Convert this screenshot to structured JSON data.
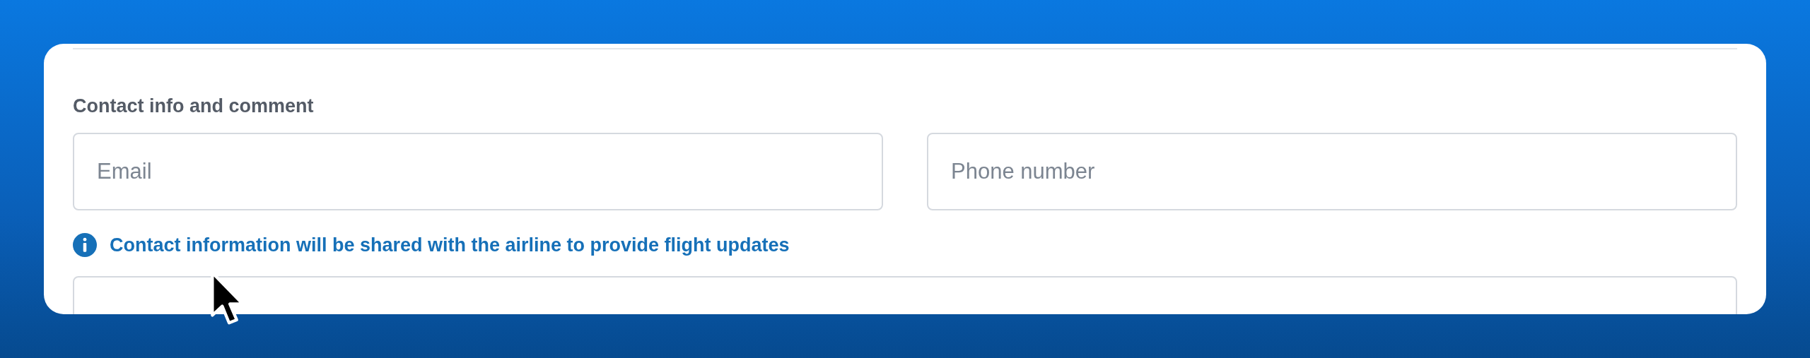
{
  "section": {
    "title": "Contact info and comment",
    "fields": [
      {
        "placeholder": "Email"
      },
      {
        "placeholder": "Phone number"
      }
    ],
    "notice": "Contact information will be shared with the airline to provide flight updates"
  }
}
